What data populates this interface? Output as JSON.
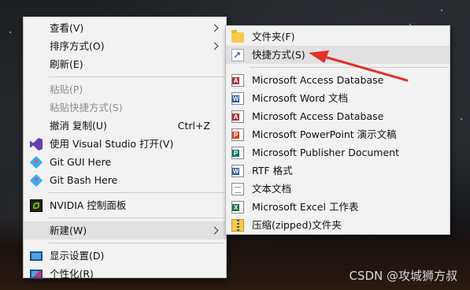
{
  "context_menu": {
    "items": [
      {
        "label": "查看(V)"
      },
      {
        "label": "排序方式(O)"
      },
      {
        "label": "刷新(E)"
      },
      {
        "label": "粘贴(P)"
      },
      {
        "label": "粘贴快捷方式(S)"
      },
      {
        "label": "撤消 复制(U)",
        "shortcut": "Ctrl+Z"
      },
      {
        "label": "使用 Visual Studio 打开(V)"
      },
      {
        "label": "Git GUI Here"
      },
      {
        "label": "Git Bash Here"
      },
      {
        "label": "NVIDIA 控制面板"
      },
      {
        "label": "新建(W)"
      },
      {
        "label": "显示设置(D)"
      },
      {
        "label": "个性化(R)"
      }
    ]
  },
  "submenu": {
    "items": [
      {
        "label": "文件夹(F)"
      },
      {
        "label": "快捷方式(S)"
      },
      {
        "label": "Microsoft Access Database",
        "icon_letter": "A",
        "color": "#a4373a"
      },
      {
        "label": "Microsoft Word 文档",
        "icon_letter": "W",
        "color": "#2b579a"
      },
      {
        "label": "Microsoft Access Database",
        "icon_letter": "A",
        "color": "#a4373a"
      },
      {
        "label": "Microsoft PowerPoint 演示文稿",
        "icon_letter": "P",
        "color": "#d24726"
      },
      {
        "label": "Microsoft Publisher Document",
        "icon_letter": "P",
        "color": "#077568"
      },
      {
        "label": "RTF 格式",
        "icon_letter": "W",
        "color": "#2b579a"
      },
      {
        "label": "文本文档"
      },
      {
        "label": "Microsoft Excel 工作表",
        "icon_letter": "X",
        "color": "#217346"
      },
      {
        "label": "压缩(zipped)文件夹"
      }
    ]
  },
  "watermark": "CSDN @攻城狮方叔",
  "colors": {
    "annotation_arrow": "#e0312a",
    "menu_bg": "#f2f2f2",
    "hover": "#e1e1e1"
  }
}
